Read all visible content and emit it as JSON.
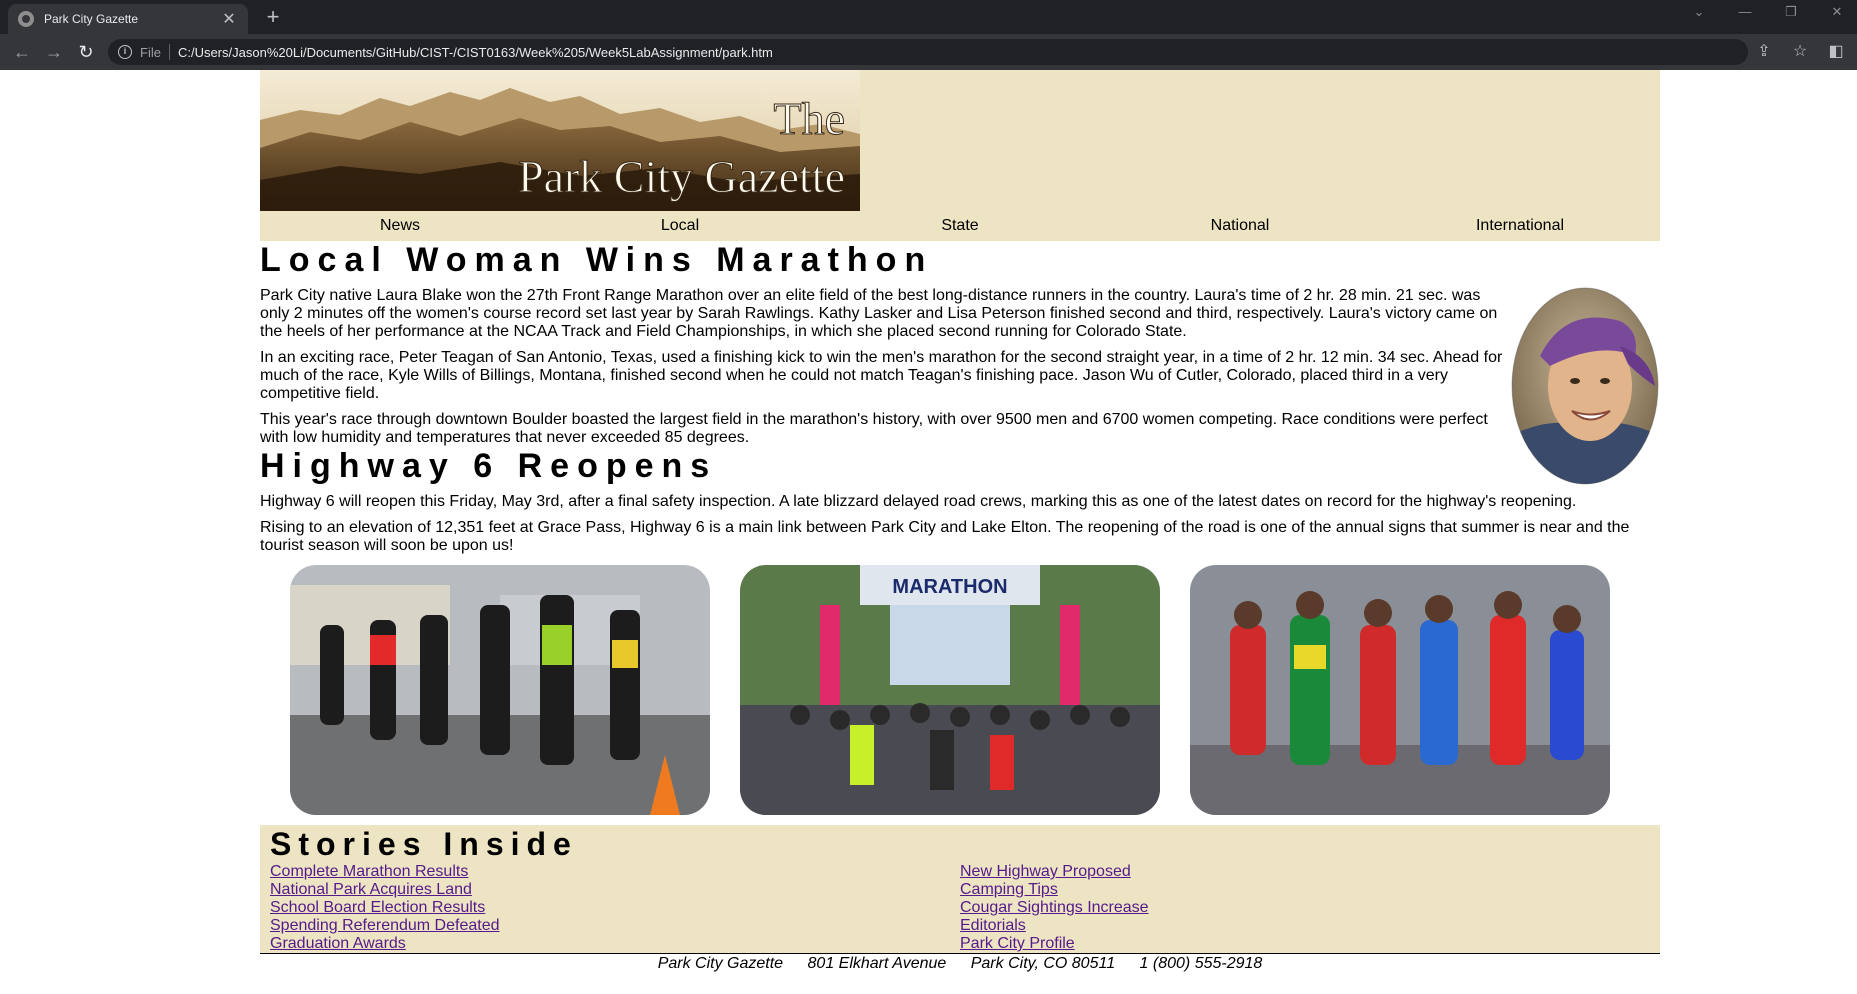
{
  "browser": {
    "tab_title": "Park City Gazette",
    "tab_close": "✕",
    "new_tab": "+",
    "scheme": "File",
    "url": "C:/Users/Jason%20Li/Documents/GitHub/CIST-/CIST0163/Week%205/Week5LabAssignment/park.htm"
  },
  "header": {
    "logo_line1": "The",
    "logo_line2": "Park City Gazette",
    "nav": [
      "News",
      "Local",
      "State",
      "National",
      "International"
    ]
  },
  "article1": {
    "title": "Local Woman Wins Marathon",
    "paragraphs": [
      "Park City native Laura Blake won the 27th Front Range Marathon over an elite field of the best long-distance runners in the country. Laura's time of 2 hr. 28 min. 21 sec. was only 2 minutes off the women's course record set last year by Sarah Rawlings. Kathy Lasker and Lisa Peterson finished second and third, respectively. Laura's victory came on the heels of her performance at the NCAA Track and Field Championships, in which she placed second running for Colorado State.",
      "In an exciting race, Peter Teagan of San Antonio, Texas, used a finishing kick to win the men's marathon for the second straight year, in a time of 2 hr. 12 min. 34 sec. Ahead for much of the race, Kyle Wills of Billings, Montana, finished second when he could not match Teagan's finishing pace. Jason Wu of Cutler, Colorado, placed third in a very competitive field.",
      "This year's race through downtown Boulder boasted the largest field in the marathon's history, with over 9500 men and 6700 women competing. Race conditions were perfect with low humidity and temperatures that never exceeded 85 degrees."
    ]
  },
  "article2": {
    "title": "Highway 6 Reopens",
    "paragraphs": [
      "Highway 6 will reopen this Friday, May 3rd, after a final safety inspection. A late blizzard delayed road crews, marking this as one of the latest dates on record for the highway's reopening.",
      "Rising to an elevation of 12,351 feet at Grace Pass, Highway 6 is a main link between Park City and Lake Elton. The reopening of the road is one of the annual signs that summer is near and the tourist season will soon be upon us!"
    ]
  },
  "photo2_banner": "MARATHON",
  "stories": {
    "title": "Stories Inside",
    "left": [
      "Complete Marathon Results",
      "National Park Acquires Land",
      "School Board Election Results",
      "Spending Referendum Defeated",
      "Graduation Awards"
    ],
    "right": [
      "New Highway Proposed",
      "Camping Tips",
      "Cougar Sightings Increase",
      "Editorials",
      "Park City Profile"
    ]
  },
  "footer": {
    "name": "Park City Gazette",
    "street": "801 Elkhart Avenue",
    "city": "Park City, CO 80511",
    "phone": "1 (800) 555-2918"
  },
  "colors": {
    "header_bg": "#ece4c2",
    "link": "#551a8b",
    "chrome_dark": "#202124",
    "chrome_mid": "#35363a"
  }
}
